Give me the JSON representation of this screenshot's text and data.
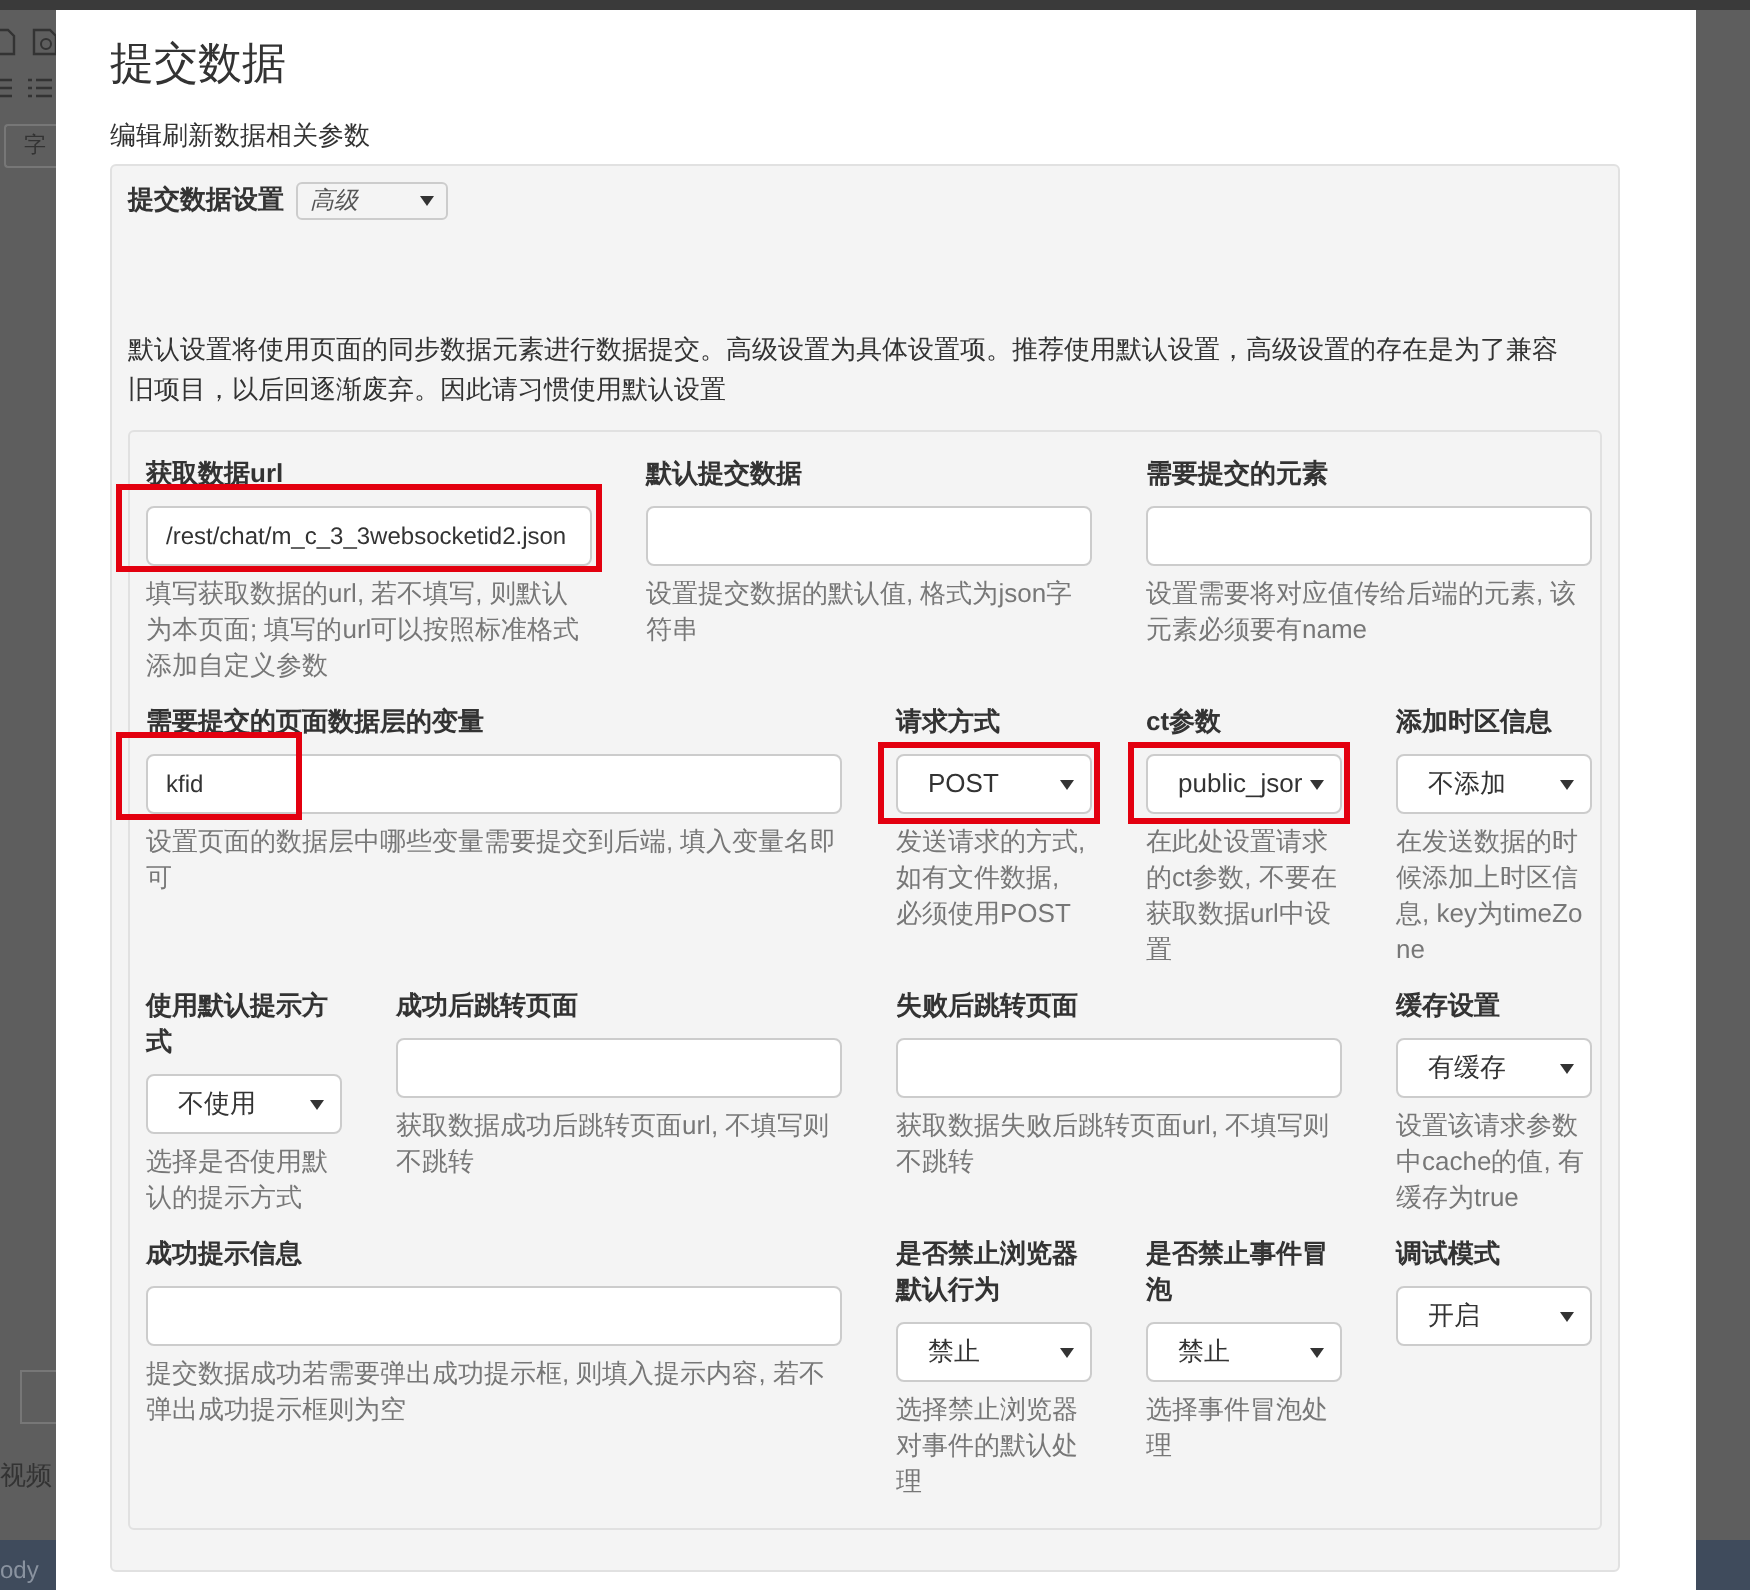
{
  "background": {
    "texts": [
      "字",
      "视频",
      "ody"
    ]
  },
  "dialog": {
    "title": "提交数据",
    "subtitle": "编辑刷新数据相关参数"
  },
  "settings": {
    "label": "提交数据设置",
    "mode": "高级",
    "description": "默认设置将使用页面的同步数据元素进行数据提交。高级设置为具体设置项。推荐使用默认设置，高级设置的存在是为了兼容旧项目，以后回逐渐废弃。因此请习惯使用默认设置"
  },
  "rows": [
    [
      {
        "label": "获取数据url",
        "kind": "text",
        "value": "/rest/chat/m_c_3_3websocketid2.json",
        "help": "填写获取数据的url, 若不填写, 则默认为本页面; 填写的url可以按照标准格式添加自定义参数",
        "highlighted": true
      },
      {
        "label": "默认提交数据",
        "kind": "text",
        "help": "设置提交数据的默认值, 格式为json字符串"
      },
      {
        "label": "需要提交的元素",
        "kind": "text",
        "help": "设置需要将对应值传给后端的元素, 该元素必须要有name"
      }
    ],
    [
      {
        "label": "需要提交的页面数据层的变量",
        "kind": "text",
        "value": "kfid",
        "help": "设置页面的数据层中哪些变量需要提交到后端, 填入变量名即可",
        "highlighted": true
      },
      {
        "label": "请求方式",
        "kind": "select",
        "value": "POST",
        "help": "发送请求的方式, 如有文件数据, 必须使用POST",
        "highlighted": true
      },
      {
        "label": "ct参数",
        "kind": "select",
        "value": "public_jsor",
        "help": "在此处设置请求的ct参数, 不要在获取数据url中设置",
        "highlighted": true
      },
      {
        "label": "添加时区信息",
        "kind": "select",
        "value": "不添加",
        "help": "在发送数据的时候添加上时区信息, key为timeZone"
      }
    ],
    [
      {
        "label": "使用默认提示方式",
        "kind": "select",
        "value": "不使用",
        "help": "选择是否使用默认的提示方式"
      },
      {
        "label": "成功后跳转页面",
        "kind": "text",
        "help": "获取数据成功后跳转页面url, 不填写则不跳转"
      },
      {
        "label": "失败后跳转页面",
        "kind": "text",
        "help": "获取数据失败后跳转页面url, 不填写则不跳转"
      },
      {
        "label": "缓存设置",
        "kind": "select",
        "value": "有缓存",
        "help": "设置该请求参数中cache的值, 有缓存为true"
      }
    ],
    [
      {
        "label": "成功提示信息",
        "kind": "text",
        "help": "提交数据成功若需要弹出成功提示框, 则填入提示内容, 若不弹出成功提示框则为空"
      },
      {
        "label": "是否禁止浏览器默认行为",
        "kind": "select",
        "value": "禁止",
        "help": "选择禁止浏览器对事件的默认处理"
      },
      {
        "label": "是否禁止事件冒泡",
        "kind": "select",
        "value": "禁止",
        "help": "选择事件冒泡处理"
      },
      {
        "label": "调试模式",
        "kind": "select",
        "value": "开启"
      }
    ]
  ]
}
